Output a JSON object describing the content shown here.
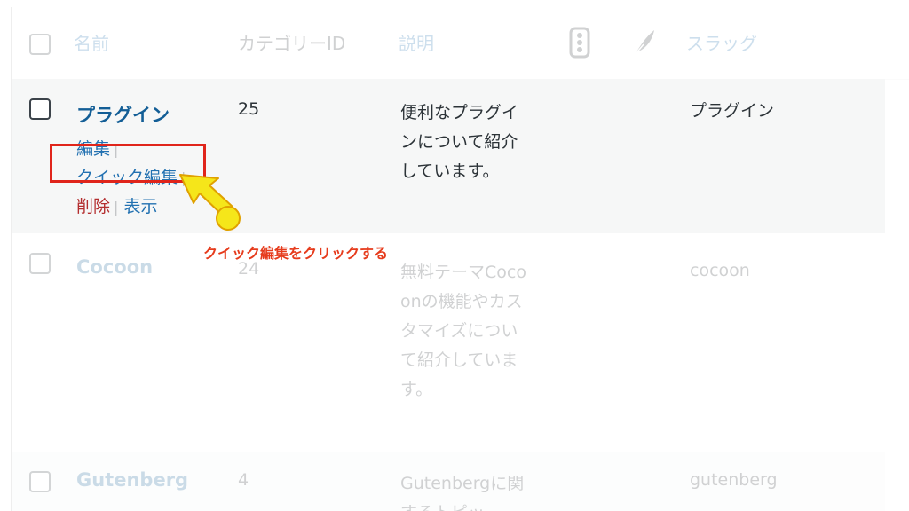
{
  "header": {
    "name": "名前",
    "category_id": "カテゴリーID",
    "description": "説明",
    "slug": "スラッグ",
    "icons": [
      "traffic-light-icon",
      "feather-icon"
    ]
  },
  "rows": [
    {
      "name": "プラグイン",
      "id": "25",
      "description": "便利なプラグインについて紹介しています。",
      "slug": "プラグイン",
      "actions": {
        "edit": "編集",
        "quick_edit": "クイック編集",
        "delete": "削除",
        "view": "表示"
      }
    },
    {
      "name": "Cocoon",
      "id": "24",
      "description": "無料テーマCocoonの機能やカスタマイズについて紹介しています。",
      "slug": "cocoon"
    },
    {
      "name": "Gutenberg",
      "id": "4",
      "description": "Gutenbergに関するトピッ",
      "slug": "gutenberg"
    }
  ],
  "annotation": {
    "label": "クイック編集をクリックする",
    "color": "#e63b1c",
    "arrow_color": "#f5e61a"
  }
}
